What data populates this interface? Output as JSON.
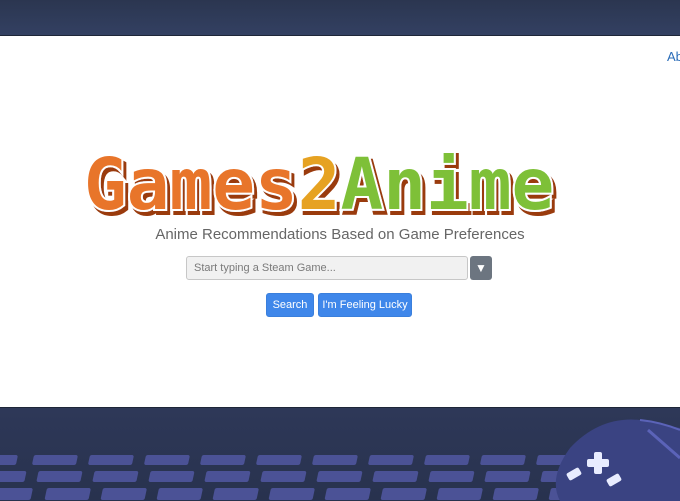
{
  "header": {
    "about_link": "About"
  },
  "logo": {
    "text_part1": "Games",
    "text_part2": "2",
    "text_part3": "Anime",
    "colors": [
      "#e8742a",
      "#e6a224",
      "#7ec038"
    ]
  },
  "subtitle": "Anime Recommendations Based on Game Preferences",
  "search": {
    "placeholder": "Start typing a Steam Game...",
    "value": "",
    "dropdown_icon": "caret-down-icon"
  },
  "buttons": {
    "search_label": "Search",
    "lucky_label": "I'm Feeling Lucky"
  },
  "colors": {
    "band": "#2e3858",
    "keys": "#4b5296",
    "button_primary": "#3f87ea",
    "dropdown": "#6c7580"
  },
  "decorations": {
    "keyboard_icon": "keyboard-icon",
    "gamepad_icon": "gamepad-icon"
  }
}
